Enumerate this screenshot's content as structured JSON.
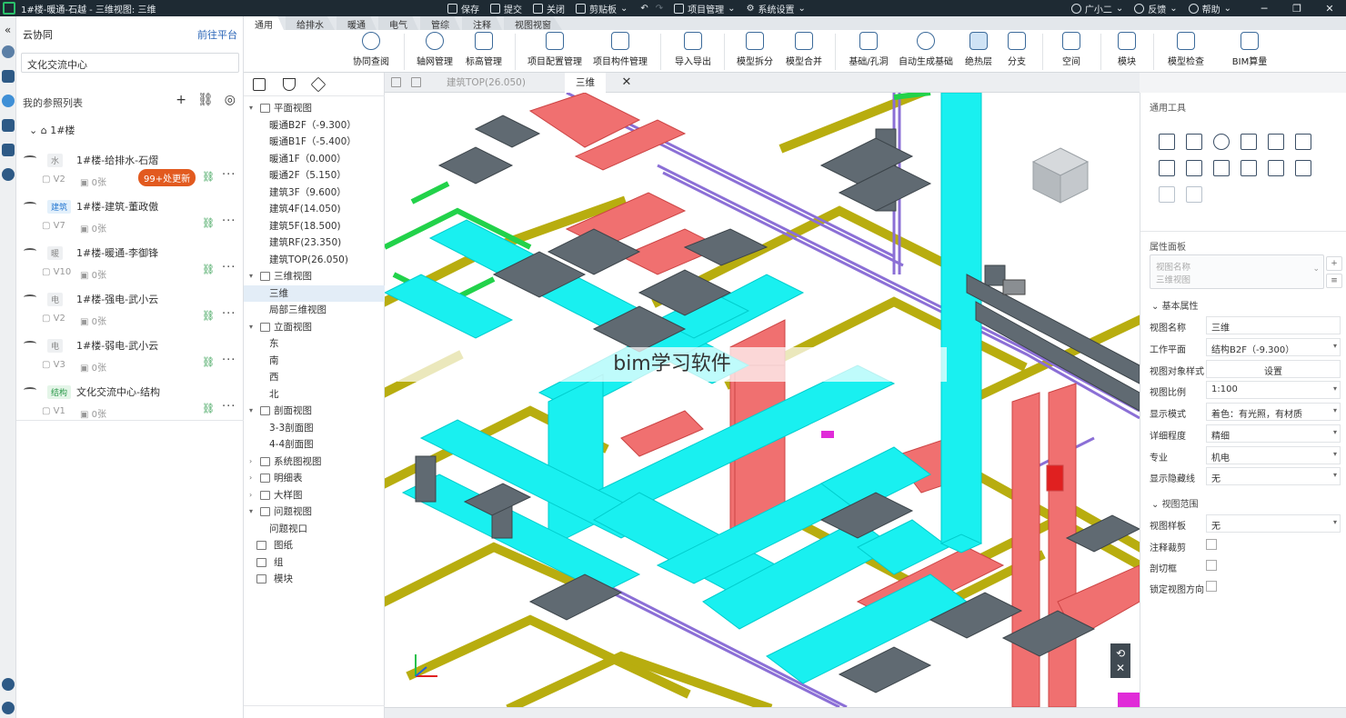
{
  "window": {
    "title": "1#楼-暖通-石越 - 三维视图: 三维",
    "toolbar": {
      "save": "保存",
      "submit": "提交",
      "close": "关闭",
      "clipboard": "剪贴板",
      "project_mgmt": "项目管理",
      "system_settings": "系统设置"
    },
    "user": "广小二",
    "feedback": "反馈",
    "help": "帮助"
  },
  "cloud": {
    "header": "云协同",
    "goto_platform": "前往平台",
    "project_name": "文化交流中心",
    "ref_list_label": "我的参照列表",
    "root_node": "1#楼",
    "refs": [
      {
        "tag": "水",
        "name": "1#楼-给排水-石熠",
        "version": "V2",
        "count": "0张",
        "badge": "99+处更新"
      },
      {
        "tag": "建筑",
        "name": "1#楼-建筑-董政傲",
        "version": "V7",
        "count": "0张"
      },
      {
        "tag": "暖",
        "name": "1#楼-暖通-李御锋",
        "version": "V10",
        "count": "0张"
      },
      {
        "tag": "电",
        "name": "1#楼-强电-武小云",
        "version": "V2",
        "count": "0张"
      },
      {
        "tag": "电",
        "name": "1#楼-弱电-武小云",
        "version": "V3",
        "count": "0张"
      },
      {
        "tag": "结构",
        "name": "文化交流中心-结构",
        "version": "V1",
        "count": "0张"
      }
    ]
  },
  "ribbon": {
    "tabs": [
      "通用",
      "给排水",
      "暖通",
      "电气",
      "管综",
      "注释",
      "视图视窗"
    ],
    "buttons": [
      "协同查阅",
      "轴网管理",
      "标高管理",
      "项目配置管理",
      "项目构件管理",
      "导入导出",
      "模型拆分",
      "模型合并",
      "基础/孔洞",
      "自动生成基础",
      "绝热层",
      "分支",
      "空间",
      "模块",
      "模型检查",
      "BIM算量"
    ]
  },
  "tree": {
    "groups": {
      "plan": "平面视图",
      "three_d": "三维视图",
      "elevation": "立面视图",
      "section": "剖面视图",
      "system": "系统图视图",
      "schedule": "明细表",
      "detail": "大样图",
      "issue": "问题视图",
      "sheet": "图纸",
      "group": "组",
      "module": "模块"
    },
    "plan_items": [
      "暖通B2F（-9.300）",
      "暖通B1F（-5.400）",
      "暖通1F（0.000）",
      "暖通2F（5.150）",
      "建筑3F（9.600）",
      "建筑4F(14.050)",
      "建筑5F(18.500)",
      "建筑RF(23.350)",
      "建筑TOP(26.050)"
    ],
    "three_d_items": [
      "三维",
      "局部三维视图"
    ],
    "elevation_items": [
      "东",
      "南",
      "西",
      "北"
    ],
    "section_items": [
      "3-3剖面图",
      "4-4剖面图"
    ],
    "issue_items": [
      "问题视口"
    ]
  },
  "view_tabs": {
    "inactive": "建筑TOP(26.050)",
    "active": "三维"
  },
  "overlay_text": "bim学习软件",
  "properties": {
    "tools_header": "通用工具",
    "panel_header": "属性面板",
    "viewname_line1": "视图名称",
    "viewname_line2": "三维视图",
    "basic_section": "基本属性",
    "range_section": "视图范围",
    "rows": [
      {
        "label": "视图名称",
        "value": "三维"
      },
      {
        "label": "工作平面",
        "value": "结构B2F（-9.300）"
      },
      {
        "label": "视图对象样式",
        "value": "设置"
      },
      {
        "label": "视图比例",
        "value": "1:100"
      },
      {
        "label": "显示模式",
        "value": "着色：有光照，有材质"
      },
      {
        "label": "详细程度",
        "value": "精细"
      },
      {
        "label": "专业",
        "value": "机电"
      },
      {
        "label": "显示隐藏线",
        "value": "无"
      }
    ],
    "range_rows": [
      {
        "label": "视图样板",
        "value": "无"
      },
      {
        "label": "注释裁剪",
        "value": ""
      },
      {
        "label": "剖切框",
        "value": ""
      },
      {
        "label": "锁定视图方向",
        "value": ""
      }
    ]
  },
  "colors": {
    "duct_cyan": "#19f0f0",
    "pipe_olive": "#b8ad0f",
    "duct_red": "#f07070",
    "pipe_purple": "#8b6fd6",
    "equip_gray": "#606a72",
    "pipe_green": "#22d24a",
    "badge_orange": "#e25a1f"
  }
}
